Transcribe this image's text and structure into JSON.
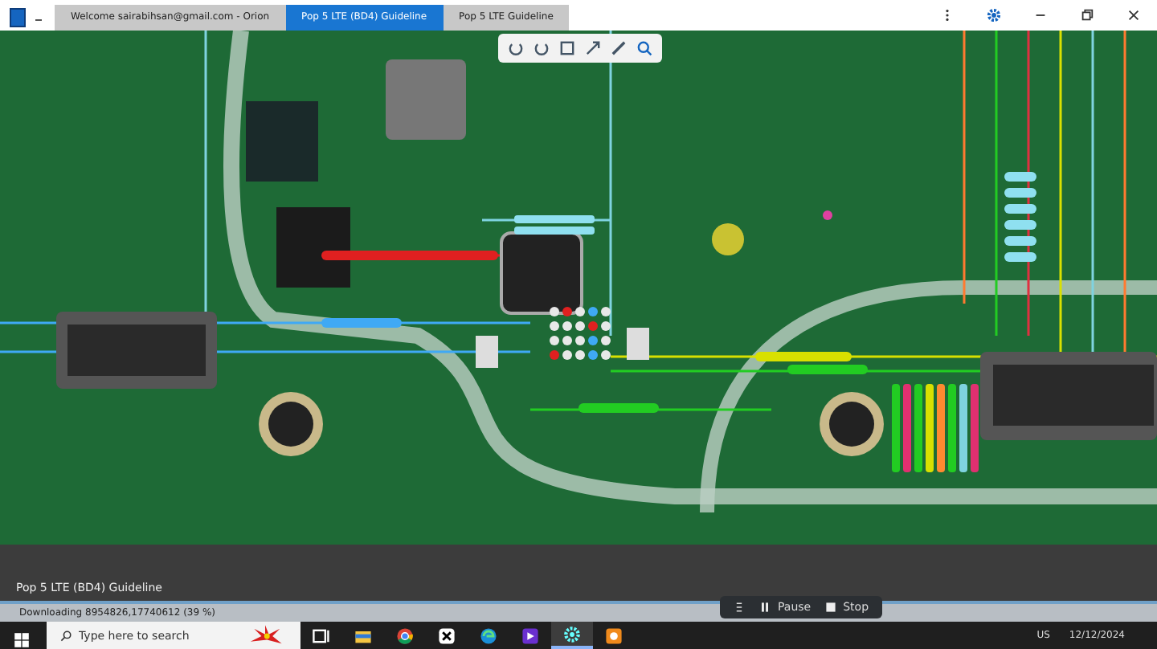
{
  "window": {
    "tabs": [
      {
        "label": "Welcome sairabihsan@gmail.com - Orion",
        "selected": false
      },
      {
        "label": "Pop 5 LTE (BD4) Guideline",
        "selected": true
      },
      {
        "label": "Pop 5 LTE Guideline",
        "selected": false
      }
    ]
  },
  "viewer": {
    "caption": "Pop 5 LTE (BD4) Guideline"
  },
  "status_bar": {
    "text": "Downloading 8954826,17740612 (39 %)"
  },
  "taskbar": {
    "search": {
      "placeholder": "Type here to search"
    },
    "apps": [
      {
        "kind": "taskview",
        "selected": false
      },
      {
        "kind": "folder",
        "selected": false
      },
      {
        "kind": "chrome",
        "selected": false
      },
      {
        "kind": "capcut",
        "selected": false
      },
      {
        "kind": "edge",
        "selected": false
      },
      {
        "kind": "video",
        "selected": false
      },
      {
        "kind": "gear",
        "selected": true
      },
      {
        "kind": "recorder",
        "selected": false
      }
    ]
  },
  "recorder": {
    "buttons": [
      "Pause",
      "Stop"
    ]
  },
  "tray": {
    "language": "US",
    "date": "12/12/2024"
  }
}
